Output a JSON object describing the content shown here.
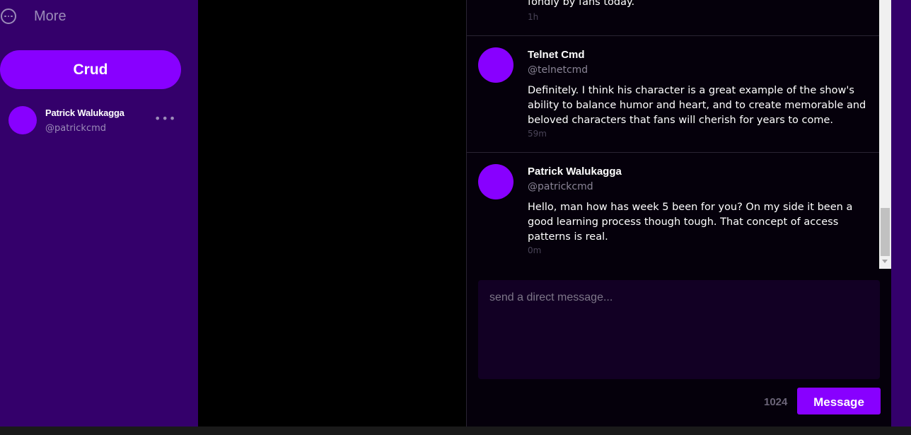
{
  "sidebar": {
    "more_icon": "more-circle-icon",
    "more_label": "More",
    "crud_label": "Crud",
    "profile": {
      "name": "Patrick Walukagga",
      "handle": "@patrickcmd",
      "menu_icon": "ellipsis-icon",
      "menu_glyph": "•••"
    }
  },
  "messages": {
    "partial": {
      "text": "fondly by fans today.",
      "time": "1h"
    },
    "items": [
      {
        "name": "Telnet Cmd",
        "handle": "@telnetcmd",
        "text": "Definitely. I think his character is a great example of the show's ability to balance humor and heart, and to create memorable and beloved characters that fans will cherish for years to come.",
        "time": "59m"
      },
      {
        "name": "Patrick Walukagga",
        "handle": "@patrickcmd",
        "text": "Hello, man how has week 5 been for you? On my side it been a good learning process though tough. That concept of access patterns is real.",
        "time": "0m"
      }
    ]
  },
  "compose": {
    "placeholder": "send a direct message...",
    "char_count": "1024",
    "send_label": "Message"
  },
  "colors": {
    "accent": "#8800ff",
    "sidebar_bg": "#34006b",
    "panel_bg": "#05000b",
    "compose_bg": "#120024"
  }
}
